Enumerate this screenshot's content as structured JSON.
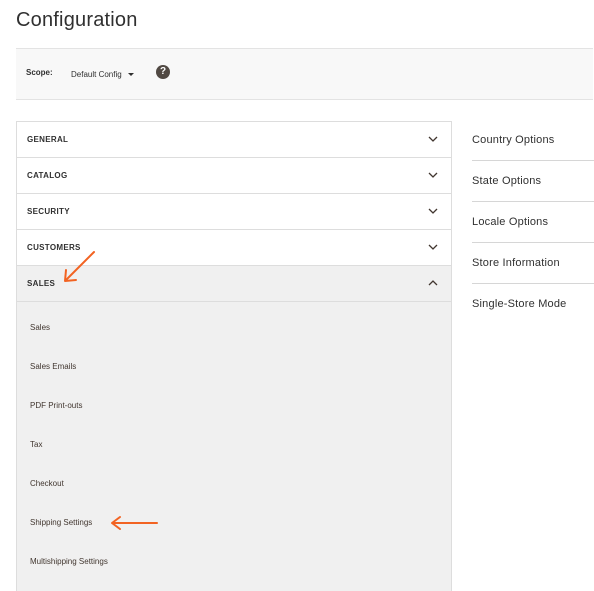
{
  "page": {
    "title": "Configuration"
  },
  "scope": {
    "label": "Scope:",
    "value": "Default Config",
    "help_icon": "?"
  },
  "tabs": [
    {
      "label": "GENERAL",
      "open": false
    },
    {
      "label": "CATALOG",
      "open": false
    },
    {
      "label": "SECURITY",
      "open": false
    },
    {
      "label": "CUSTOMERS",
      "open": false
    },
    {
      "label": "SALES",
      "open": true
    }
  ],
  "sales_items": [
    "Sales",
    "Sales Emails",
    "PDF Print-outs",
    "Tax",
    "Checkout",
    "Shipping Settings",
    "Multishipping Settings"
  ],
  "side_nav": [
    "Country Options",
    "State Options",
    "Locale Options",
    "Store Information",
    "Single-Store Mode"
  ],
  "colors": {
    "annotation_arrow": "#f26322",
    "help_icon_bg": "#514943",
    "open_tab_bg": "#f0f0f0"
  },
  "icons": {
    "tab_collapsed": "chevron-down-icon",
    "tab_expanded": "chevron-up-icon",
    "help": "question-circle-icon",
    "annotation": "arrow-icon"
  }
}
